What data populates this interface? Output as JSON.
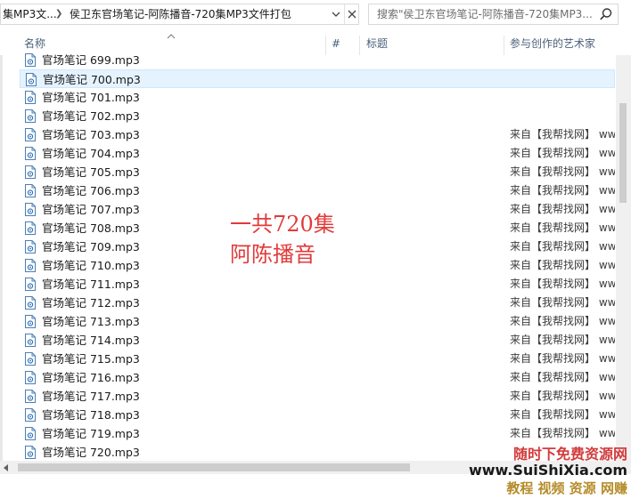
{
  "address_bar": {
    "prev_segment": "集MP3文...",
    "current_folder": "侯卫东官场笔记-阿陈播音-720集MP3文件打包"
  },
  "search": {
    "placeholder": "搜索\"侯卫东官场笔记-阿陈播音-720集MP3..."
  },
  "columns": {
    "name": "名称",
    "number": "#",
    "title": "标题",
    "artist": "参与创作的艺术家"
  },
  "files": [
    {
      "name": "官场笔记 699.mp3",
      "artist": ""
    },
    {
      "name": "官场笔记 700.mp3",
      "artist": ""
    },
    {
      "name": "官场笔记 701.mp3",
      "artist": ""
    },
    {
      "name": "官场笔记 702.mp3",
      "artist": ""
    },
    {
      "name": "官场笔记 703.mp3",
      "artist": "来自【我帮找网】  ww"
    },
    {
      "name": "官场笔记 704.mp3",
      "artist": "来自【我帮找网】  ww"
    },
    {
      "name": "官场笔记 705.mp3",
      "artist": "来自【我帮找网】  ww"
    },
    {
      "name": "官场笔记 706.mp3",
      "artist": "来自【我帮找网】  ww"
    },
    {
      "name": "官场笔记 707.mp3",
      "artist": "来自【我帮找网】  ww"
    },
    {
      "name": "官场笔记 708.mp3",
      "artist": "来自【我帮找网】  ww"
    },
    {
      "name": "官场笔记 709.mp3",
      "artist": "来自【我帮找网】  ww"
    },
    {
      "name": "官场笔记 710.mp3",
      "artist": "来自【我帮找网】  ww"
    },
    {
      "name": "官场笔记 711.mp3",
      "artist": "来自【我帮找网】  ww"
    },
    {
      "name": "官场笔记 712.mp3",
      "artist": "来自【我帮找网】  ww"
    },
    {
      "name": "官场笔记 713.mp3",
      "artist": "来自【我帮找网】  ww"
    },
    {
      "name": "官场笔记 714.mp3",
      "artist": "来自【我帮找网】  ww"
    },
    {
      "name": "官场笔记 715.mp3",
      "artist": "来自【我帮找网】  ww"
    },
    {
      "name": "官场笔记 716.mp3",
      "artist": "来自【我帮找网】  ww"
    },
    {
      "name": "官场笔记 717.mp3",
      "artist": "来自【我帮找网】  ww"
    },
    {
      "name": "官场笔记 718.mp3",
      "artist": "来自【我帮找网】  ww"
    },
    {
      "name": "官场笔记 719.mp3",
      "artist": "来自【我帮找网】  ww"
    },
    {
      "name": "官场笔记 720.mp3",
      "artist": ""
    }
  ],
  "highlighted_index": 1,
  "annotation": {
    "line1": "一共720集",
    "line2": "阿陈播音"
  },
  "watermark": {
    "line1": "随时下免费资源网",
    "line2": "www.SuiShiXia.com",
    "line3": "教程 视频 资源 网赚"
  },
  "colors": {
    "accent_red": "#e23a3a",
    "highlight": "#e5f3ff",
    "header_text": "#4c607a"
  }
}
